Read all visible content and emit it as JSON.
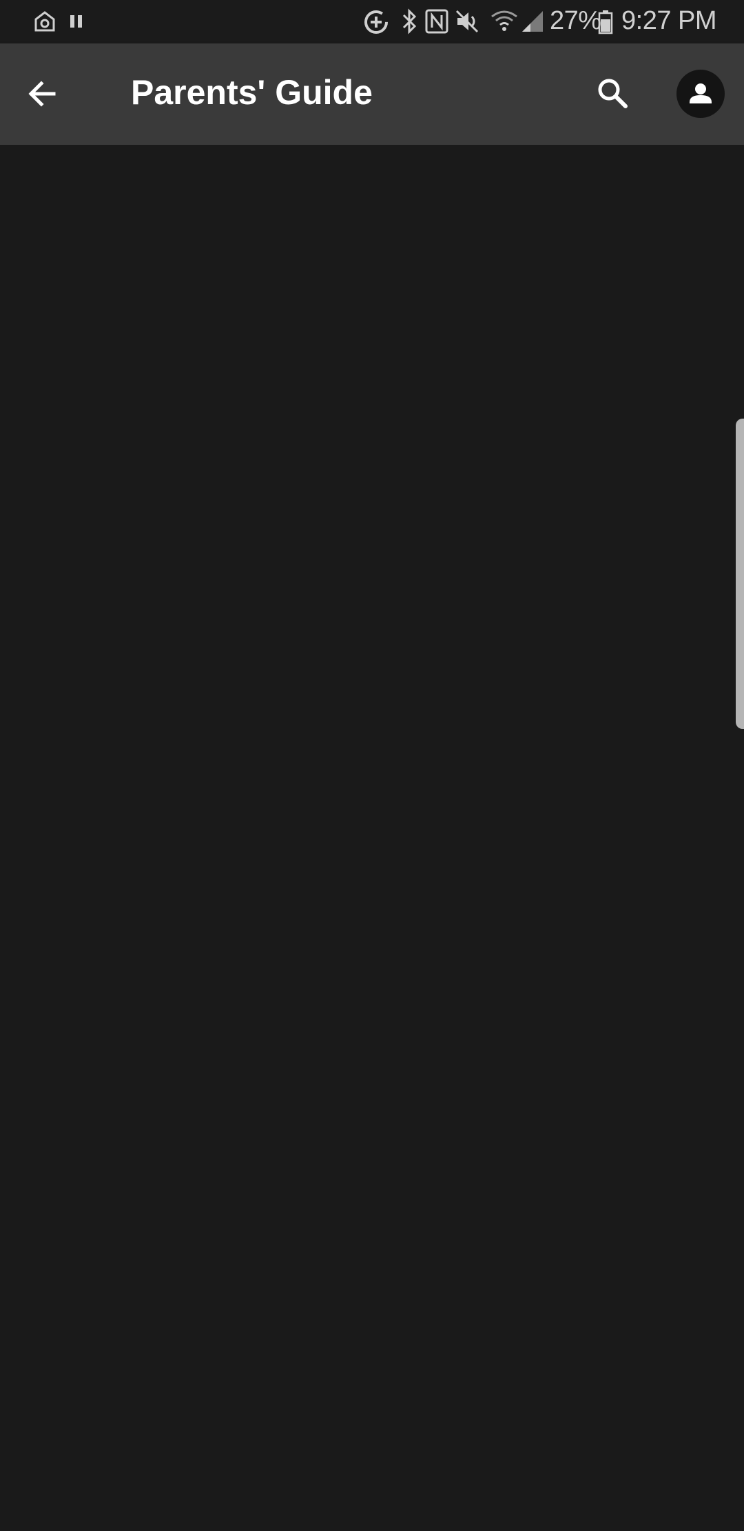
{
  "status_bar": {
    "battery_percent": "27%",
    "time": "9:27 PM",
    "icons": [
      "home-camera-icon",
      "pause-icon",
      "data-saver-icon",
      "bluetooth-icon",
      "nfc-icon",
      "mute-icon",
      "wifi-icon",
      "signal-icon",
      "battery-icon"
    ]
  },
  "app_bar": {
    "title": "Parents' Guide",
    "back_icon": "arrow-left-icon",
    "search_icon": "search-icon",
    "account_icon": "account-icon"
  },
  "colors": {
    "background": "#1a1a1a",
    "app_bar": "#3a3a3a",
    "title_text": "#ffffff"
  }
}
